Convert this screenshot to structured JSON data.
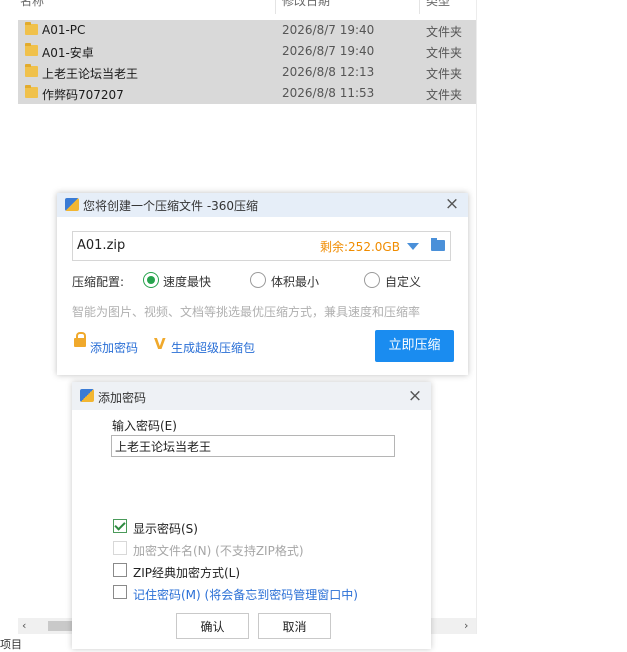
{
  "explorer": {
    "columns": {
      "name": "名称",
      "date": "修改日期",
      "type": "类型"
    },
    "files": [
      {
        "name": "A01-PC",
        "date": "2026/8/7 19:40",
        "type": "文件夹"
      },
      {
        "name": "A01-安卓",
        "date": "2026/8/7 19:40",
        "type": "文件夹"
      },
      {
        "name": "上老王论坛当老王",
        "date": "2026/8/8 12:13",
        "type": "文件夹"
      },
      {
        "name": "作弊码707207",
        "date": "2026/8/8 11:53",
        "type": "文件夹"
      }
    ],
    "status_text": "项目",
    "scroll_left": "‹",
    "scroll_right": "›"
  },
  "compress_dialog": {
    "title": "您将创建一个压缩文件 -360压缩",
    "close": "×",
    "archive_name": "A01.zip",
    "space_left": "剩余:252.0GB",
    "config_label": "压缩配置:",
    "options": [
      {
        "label": "速度最快",
        "checked": true
      },
      {
        "label": "体积最小",
        "checked": false
      },
      {
        "label": "自定义",
        "checked": false
      }
    ],
    "hint": "智能为图片、视频、文档等挑选最优压缩方式，兼具速度和压缩率",
    "add_password_link": "添加密码",
    "super_zip_icon": "V",
    "super_zip_link": "生成超级压缩包",
    "compress_button": "立即压缩"
  },
  "password_dialog": {
    "title": "添加密码",
    "close": "×",
    "password_label": "输入密码(E)",
    "password_value": "上老王论坛当老王",
    "checkboxes": [
      {
        "label": "显示密码(S)",
        "checked": true,
        "disabled": false,
        "style": "normal"
      },
      {
        "label": "加密文件名(N) (不支持ZIP格式)",
        "checked": false,
        "disabled": true,
        "style": "disabled"
      },
      {
        "label": "ZIP经典加密方式(L)",
        "checked": false,
        "disabled": false,
        "style": "normal"
      },
      {
        "label": "记住密码(M) (将会备忘到密码管理窗口中)",
        "checked": false,
        "disabled": false,
        "style": "blue"
      }
    ],
    "ok_button": "确认",
    "cancel_button": "取消"
  },
  "colors": {
    "accent_blue": "#1a8cf0",
    "link_blue": "#2a6fd6",
    "orange": "#f08c00",
    "checked_green": "#27a34d",
    "selected_row": "#d9d9d9"
  }
}
